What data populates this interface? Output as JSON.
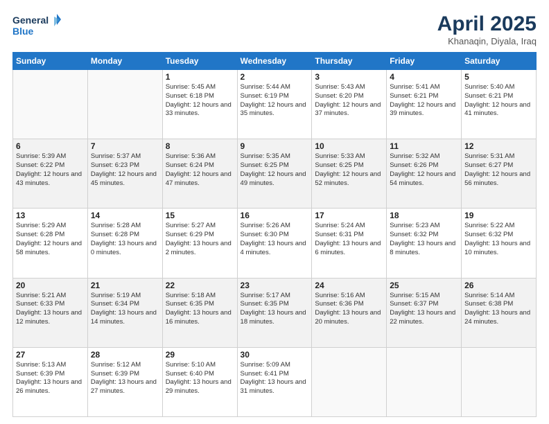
{
  "logo": {
    "line1": "General",
    "line2": "Blue"
  },
  "title": "April 2025",
  "subtitle": "Khanaqin, Diyala, Iraq",
  "days_header": [
    "Sunday",
    "Monday",
    "Tuesday",
    "Wednesday",
    "Thursday",
    "Friday",
    "Saturday"
  ],
  "weeks": [
    [
      {
        "day": "",
        "info": ""
      },
      {
        "day": "",
        "info": ""
      },
      {
        "day": "1",
        "info": "Sunrise: 5:45 AM\nSunset: 6:18 PM\nDaylight: 12 hours and 33 minutes."
      },
      {
        "day": "2",
        "info": "Sunrise: 5:44 AM\nSunset: 6:19 PM\nDaylight: 12 hours and 35 minutes."
      },
      {
        "day": "3",
        "info": "Sunrise: 5:43 AM\nSunset: 6:20 PM\nDaylight: 12 hours and 37 minutes."
      },
      {
        "day": "4",
        "info": "Sunrise: 5:41 AM\nSunset: 6:21 PM\nDaylight: 12 hours and 39 minutes."
      },
      {
        "day": "5",
        "info": "Sunrise: 5:40 AM\nSunset: 6:21 PM\nDaylight: 12 hours and 41 minutes."
      }
    ],
    [
      {
        "day": "6",
        "info": "Sunrise: 5:39 AM\nSunset: 6:22 PM\nDaylight: 12 hours and 43 minutes."
      },
      {
        "day": "7",
        "info": "Sunrise: 5:37 AM\nSunset: 6:23 PM\nDaylight: 12 hours and 45 minutes."
      },
      {
        "day": "8",
        "info": "Sunrise: 5:36 AM\nSunset: 6:24 PM\nDaylight: 12 hours and 47 minutes."
      },
      {
        "day": "9",
        "info": "Sunrise: 5:35 AM\nSunset: 6:25 PM\nDaylight: 12 hours and 49 minutes."
      },
      {
        "day": "10",
        "info": "Sunrise: 5:33 AM\nSunset: 6:25 PM\nDaylight: 12 hours and 52 minutes."
      },
      {
        "day": "11",
        "info": "Sunrise: 5:32 AM\nSunset: 6:26 PM\nDaylight: 12 hours and 54 minutes."
      },
      {
        "day": "12",
        "info": "Sunrise: 5:31 AM\nSunset: 6:27 PM\nDaylight: 12 hours and 56 minutes."
      }
    ],
    [
      {
        "day": "13",
        "info": "Sunrise: 5:29 AM\nSunset: 6:28 PM\nDaylight: 12 hours and 58 minutes."
      },
      {
        "day": "14",
        "info": "Sunrise: 5:28 AM\nSunset: 6:28 PM\nDaylight: 13 hours and 0 minutes."
      },
      {
        "day": "15",
        "info": "Sunrise: 5:27 AM\nSunset: 6:29 PM\nDaylight: 13 hours and 2 minutes."
      },
      {
        "day": "16",
        "info": "Sunrise: 5:26 AM\nSunset: 6:30 PM\nDaylight: 13 hours and 4 minutes."
      },
      {
        "day": "17",
        "info": "Sunrise: 5:24 AM\nSunset: 6:31 PM\nDaylight: 13 hours and 6 minutes."
      },
      {
        "day": "18",
        "info": "Sunrise: 5:23 AM\nSunset: 6:32 PM\nDaylight: 13 hours and 8 minutes."
      },
      {
        "day": "19",
        "info": "Sunrise: 5:22 AM\nSunset: 6:32 PM\nDaylight: 13 hours and 10 minutes."
      }
    ],
    [
      {
        "day": "20",
        "info": "Sunrise: 5:21 AM\nSunset: 6:33 PM\nDaylight: 13 hours and 12 minutes."
      },
      {
        "day": "21",
        "info": "Sunrise: 5:19 AM\nSunset: 6:34 PM\nDaylight: 13 hours and 14 minutes."
      },
      {
        "day": "22",
        "info": "Sunrise: 5:18 AM\nSunset: 6:35 PM\nDaylight: 13 hours and 16 minutes."
      },
      {
        "day": "23",
        "info": "Sunrise: 5:17 AM\nSunset: 6:35 PM\nDaylight: 13 hours and 18 minutes."
      },
      {
        "day": "24",
        "info": "Sunrise: 5:16 AM\nSunset: 6:36 PM\nDaylight: 13 hours and 20 minutes."
      },
      {
        "day": "25",
        "info": "Sunrise: 5:15 AM\nSunset: 6:37 PM\nDaylight: 13 hours and 22 minutes."
      },
      {
        "day": "26",
        "info": "Sunrise: 5:14 AM\nSunset: 6:38 PM\nDaylight: 13 hours and 24 minutes."
      }
    ],
    [
      {
        "day": "27",
        "info": "Sunrise: 5:13 AM\nSunset: 6:39 PM\nDaylight: 13 hours and 26 minutes."
      },
      {
        "day": "28",
        "info": "Sunrise: 5:12 AM\nSunset: 6:39 PM\nDaylight: 13 hours and 27 minutes."
      },
      {
        "day": "29",
        "info": "Sunrise: 5:10 AM\nSunset: 6:40 PM\nDaylight: 13 hours and 29 minutes."
      },
      {
        "day": "30",
        "info": "Sunrise: 5:09 AM\nSunset: 6:41 PM\nDaylight: 13 hours and 31 minutes."
      },
      {
        "day": "",
        "info": ""
      },
      {
        "day": "",
        "info": ""
      },
      {
        "day": "",
        "info": ""
      }
    ]
  ]
}
